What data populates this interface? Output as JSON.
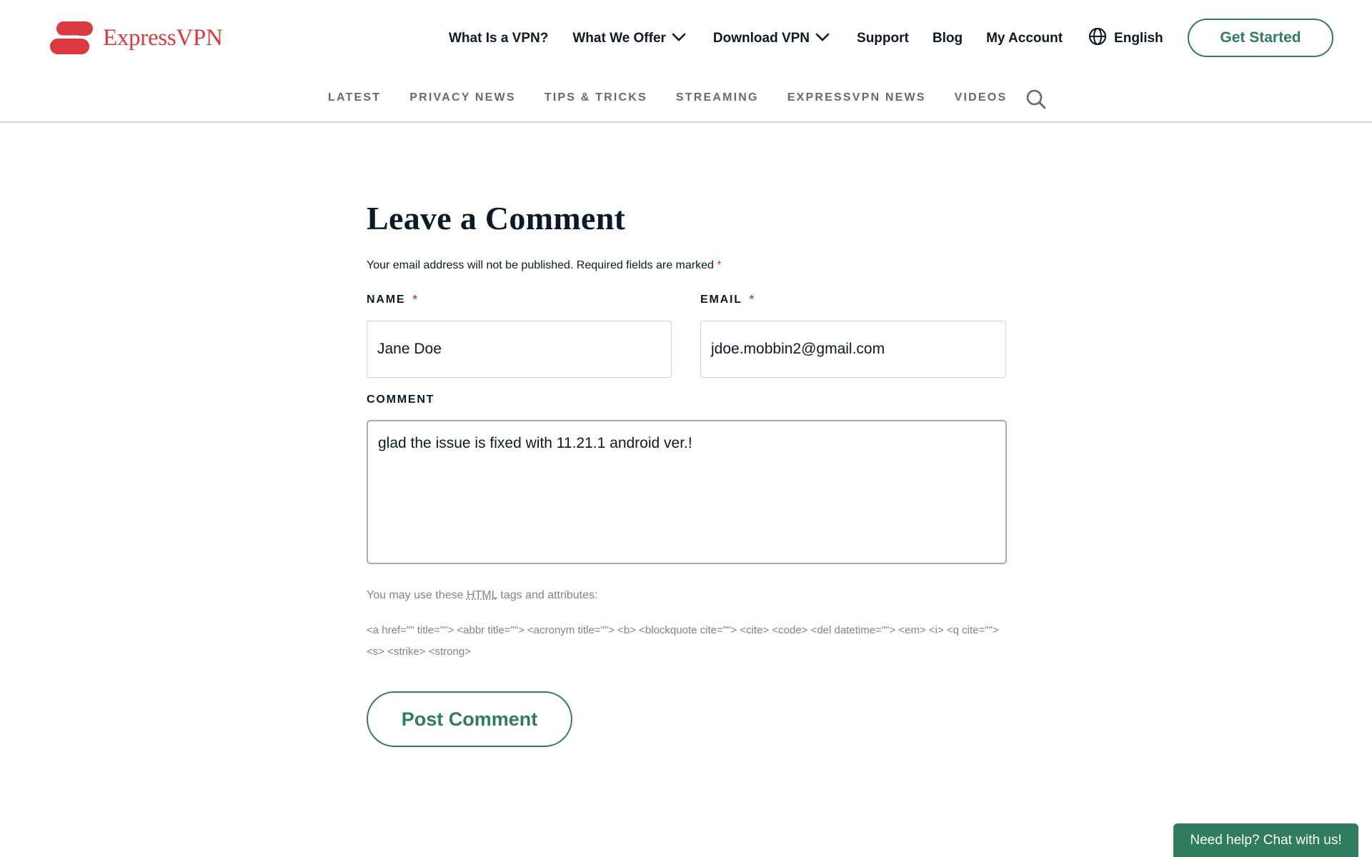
{
  "header": {
    "logo_text": "ExpressVPN",
    "nav": [
      {
        "label": "What Is a VPN?",
        "dropdown": false
      },
      {
        "label": "What We Offer",
        "dropdown": true
      },
      {
        "label": "Download VPN",
        "dropdown": true
      },
      {
        "label": "Support",
        "dropdown": false
      },
      {
        "label": "Blog",
        "dropdown": false
      },
      {
        "label": "My Account",
        "dropdown": false
      }
    ],
    "language": "English",
    "cta": "Get Started"
  },
  "subnav": {
    "items": [
      "LATEST",
      "PRIVACY NEWS",
      "TIPS & TRICKS",
      "STREAMING",
      "EXPRESSVPN NEWS",
      "VIDEOS"
    ],
    "search_icon": "search-icon"
  },
  "form": {
    "title": "Leave a Comment",
    "note": "Your email address will not be published. Required fields are marked",
    "required_mark": "*",
    "name_label": "NAME",
    "name_value": "Jane Doe",
    "email_label": "EMAIL",
    "email_value": "jdoe.mobbin2@gmail.com",
    "comment_label": "COMMENT",
    "comment_value": "glad the issue is fixed with 11.21.1 android ver.!",
    "hint_prefix": "You may use these",
    "hint_abbr": "HTML",
    "hint_suffix": "tags and attributes:",
    "allowed_tags": "<a href=\"\" title=\"\"> <abbr title=\"\"> <acronym title=\"\"> <b> <blockquote cite=\"\"> <cite> <code> <del datetime=\"\"> <em> <i> <q cite=\"\"> <s> <strike> <strong>",
    "submit": "Post Comment"
  },
  "chat": {
    "label": "Need help? Chat with us!"
  },
  "colors": {
    "brand_red": "#da3940",
    "accent_green": "#2f7d5c",
    "text_dark": "#0b1a28",
    "muted_gray": "#7d858c"
  }
}
